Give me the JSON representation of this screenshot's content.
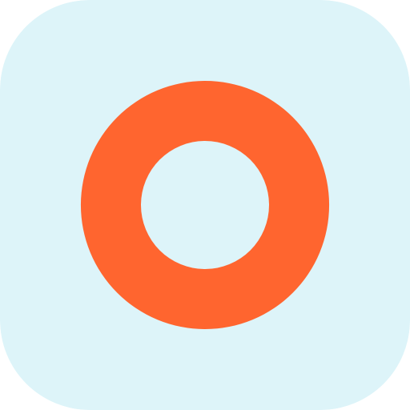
{
  "app_icon": {
    "icon": "ring-icon",
    "background_color": "#DDF4F9",
    "ring_color": "#FF652F"
  }
}
